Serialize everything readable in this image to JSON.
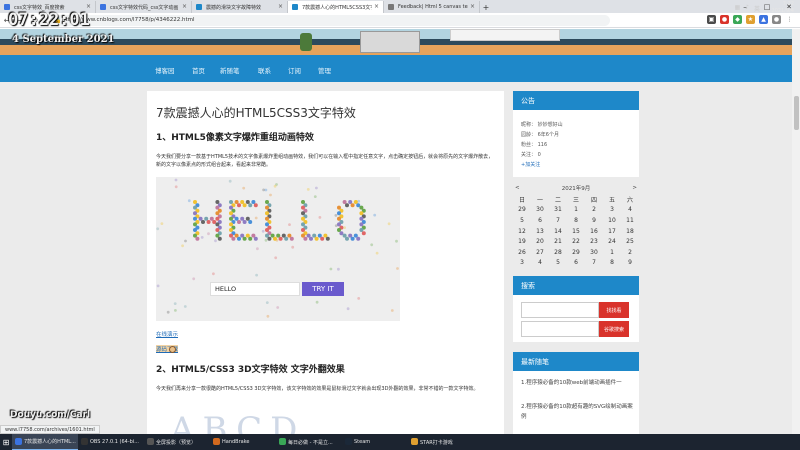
{
  "overlay": {
    "clock": "07:22:01",
    "date": "4 September 2021",
    "watermark": "Douyu.com/Carl"
  },
  "browser": {
    "tabs": [
      {
        "label": "css文字特效_百度搜索",
        "color": "#3b73e0",
        "active": false
      },
      {
        "label": "css文字特效代码_css文字动画",
        "color": "#3b73e0",
        "active": false
      },
      {
        "label": "震撼的滑块文字故障特效",
        "color": "#1e88c9",
        "active": false
      },
      {
        "label": "7款震撼人心的HTML5CSS3文字特",
        "color": "#1e88c9",
        "active": true
      },
      {
        "label": "Feedback| Html 5 canvas text",
        "color": "#777777",
        "active": false
      }
    ],
    "new_tab": "+",
    "url": "https://www.cnblogs.com/l7758/p/4346222.html",
    "status_url": "www.l7758.com/archives/1601.html"
  },
  "site": {
    "nav": [
      "博客园",
      "首页",
      "新随笔",
      "联系",
      "订阅",
      "管理"
    ]
  },
  "article": {
    "title": "7款震撼人心的HTML5CSS3文字特效",
    "section1": "1、HTML5像素文字爆炸重组动画特效",
    "para1": "今天我们要分享一款基于HTML5技术的文字像素爆炸重组动画特效，我们可以在输入框中指定任意文字，点击确定按钮后，就会将原先的文字爆炸散去，新的文字以像素点的形式组合起来，看起来非常酷。",
    "demo": {
      "word": "HELLO",
      "input_value": "HELLO",
      "button": "TRY IT"
    },
    "link1": "在线演示",
    "link2": "源码下载",
    "section2": "2、HTML5/CSS3 3D文字特效 文字外翻效果",
    "para2": "今天我们再来分享一款很酷的HTML5/CSS3 3D文字特效，该文字特效的效果是鼠标滑过文字就会出现3D外翻的效果，非常不错的一款文字特效。",
    "preview_letters": "ABCD"
  },
  "sidebar": {
    "notice": {
      "title": "公告",
      "lines": [
        "昵称：  妙妙想好山",
        "园龄：  6年6个月",
        "粉丝：  116",
        "关注：  0",
        "+加关注"
      ]
    },
    "calendar": {
      "prev": "<",
      "title": "2021年9月",
      "next": ">",
      "weekdays": [
        "日",
        "一",
        "二",
        "三",
        "四",
        "五",
        "六"
      ],
      "weeks": [
        [
          "29",
          "30",
          "31",
          "1",
          "2",
          "3",
          "4"
        ],
        [
          "5",
          "6",
          "7",
          "8",
          "9",
          "10",
          "11"
        ],
        [
          "12",
          "13",
          "14",
          "15",
          "16",
          "17",
          "18"
        ],
        [
          "19",
          "20",
          "21",
          "22",
          "23",
          "24",
          "25"
        ],
        [
          "26",
          "27",
          "28",
          "29",
          "30",
          "1",
          "2"
        ],
        [
          "3",
          "4",
          "5",
          "6",
          "7",
          "8",
          "9"
        ]
      ]
    },
    "search": {
      "title": "搜索",
      "btn1": "找找看",
      "btn2": "谷歌搜索"
    },
    "recent": {
      "title": "最新随笔",
      "items": [
        "1.程序猿必备的10款web前端动画插件一",
        "2.程序猿必备的10款超有趣的SVG绘制动画案例"
      ]
    }
  },
  "taskbar": {
    "items": [
      {
        "label": "7款震撼人心的HTML...",
        "color": "#3b73e0",
        "active": true
      },
      {
        "label": "OBS 27.0.1 (64-bi...",
        "color": "#333333",
        "active": false
      },
      {
        "label": "全屏投影（预览）",
        "color": "#555555",
        "active": false
      },
      {
        "label": "HandBrake",
        "color": "#d2691e",
        "active": false
      },
      {
        "label": "每日必做 - 不是立...",
        "color": "#3aa757",
        "active": false
      },
      {
        "label": "Steam",
        "color": "#1b2838",
        "active": false
      },
      {
        "label": "STAR打卡游戏",
        "color": "#e0a030",
        "active": false
      }
    ],
    "time": "7:22",
    "date": "2021/9/4"
  }
}
